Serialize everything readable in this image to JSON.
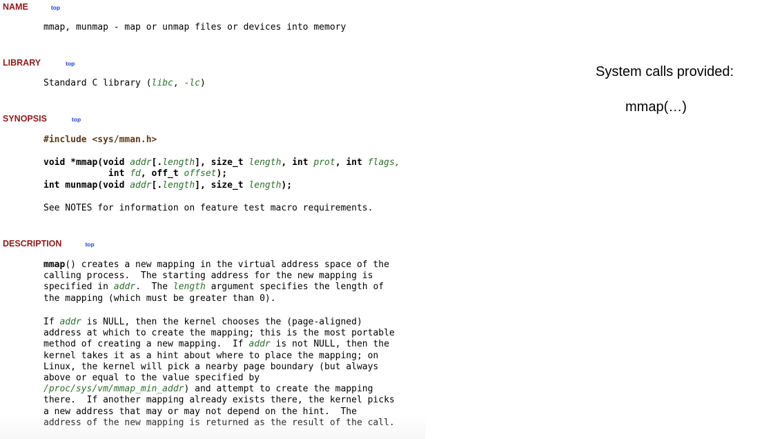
{
  "manpage": {
    "sections": {
      "name": {
        "title": "NAME",
        "top_link": "top"
      },
      "library": {
        "title": "LIBRARY",
        "top_link": "top"
      },
      "synopsis": {
        "title": "SYNOPSIS",
        "top_link": "top"
      },
      "description": {
        "title": "DESCRIPTION",
        "top_link": "top"
      }
    },
    "name_text": "mmap, munmap - map or unmap files or devices into memory",
    "library": {
      "prefix": "Standard C library (",
      "libc": "libc",
      "sep": ", ",
      "lc": "-lc",
      "suffix": ")"
    },
    "synopsis": {
      "include": "#include <sys/mman.h>",
      "mmap_line1": {
        "a": "void *mmap(void ",
        "b": "addr",
        "c": "[.",
        "d": "length",
        "e": "], size_t ",
        "f": "length",
        "g": ", int ",
        "h": "prot",
        "j": ", int ",
        "k": "flags",
        "m": ","
      },
      "mmap_line2": {
        "indent": "            ",
        "a": "int ",
        "b": "fd",
        "c": ", off_t ",
        "d": "offset",
        "e": ");"
      },
      "munmap_line": {
        "a": "int munmap(void ",
        "b": "addr",
        "c": "[.",
        "d": "length",
        "e": "], size_t ",
        "f": "length",
        "g": ");"
      },
      "notes": "See NOTES for information on feature test macro requirements."
    },
    "description": {
      "p1": {
        "l1_a": "mmap",
        "l1_b": "() creates a new mapping in the virtual address space of the",
        "l2": "calling process.  The starting address for the new mapping is",
        "l3_a": "specified in ",
        "l3_b": "addr",
        "l3_c": ".  The ",
        "l3_d": "length",
        "l3_e": " argument specifies the length of",
        "l4": "the mapping (which must be greater than 0)."
      },
      "p2": {
        "l1_a": "If ",
        "l1_b": "addr",
        "l1_c": " is NULL, then the kernel chooses the (page-aligned)",
        "l2": "address at which to create the mapping; this is the most portable",
        "l3_a": "method of creating a new mapping.  If ",
        "l3_b": "addr",
        "l3_c": " is not NULL, then the",
        "l4": "kernel takes it as a hint about where to place the mapping; on",
        "l5": "Linux, the kernel will pick a nearby page boundary (but always",
        "l6": "above or equal to the value specified by",
        "l7_a": "/proc/sys/vm/mmap_min_addr",
        "l7_b": ") and attempt to create the mapping",
        "l8": "there.  If another mapping already exists there, the kernel picks",
        "l9": "a new address that may or may not depend on the hint.  The",
        "l10": "address of the new mapping is returned as the result of the call."
      }
    }
  },
  "side_panel": {
    "title": "System calls provided:",
    "item": "mmap(…)"
  }
}
